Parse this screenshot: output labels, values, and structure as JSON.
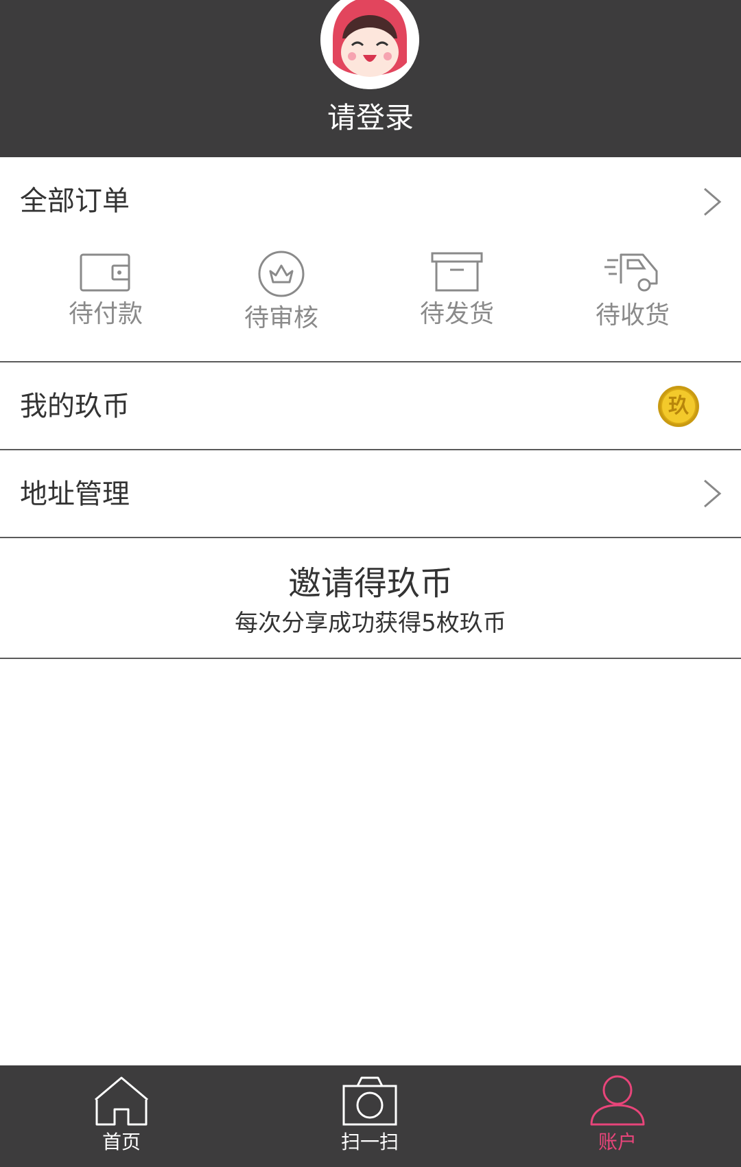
{
  "header": {
    "login_label": "请登录"
  },
  "orders": {
    "title": "全部订单",
    "statuses": [
      {
        "label": "待付款",
        "icon": "wallet-icon"
      },
      {
        "label": "待审核",
        "icon": "review-icon"
      },
      {
        "label": "待发货",
        "icon": "box-icon"
      },
      {
        "label": "待收货",
        "icon": "truck-icon"
      }
    ]
  },
  "coins": {
    "title": "我的玖币",
    "badge_text": "玖"
  },
  "address": {
    "title": "地址管理"
  },
  "invite": {
    "title": "邀请得玖币",
    "subtitle": "每次分享成功获得5枚玖币"
  },
  "tabbar": {
    "items": [
      {
        "label": "首页",
        "icon": "home-icon"
      },
      {
        "label": "扫一扫",
        "icon": "camera-icon"
      },
      {
        "label": "账户",
        "icon": "user-icon"
      }
    ],
    "active_index": 2
  },
  "colors": {
    "header_bg": "#3d3c3d",
    "accent": "#e8457a",
    "icon_gray": "#8a8a8a",
    "coin_gold": "#e0b21c"
  }
}
